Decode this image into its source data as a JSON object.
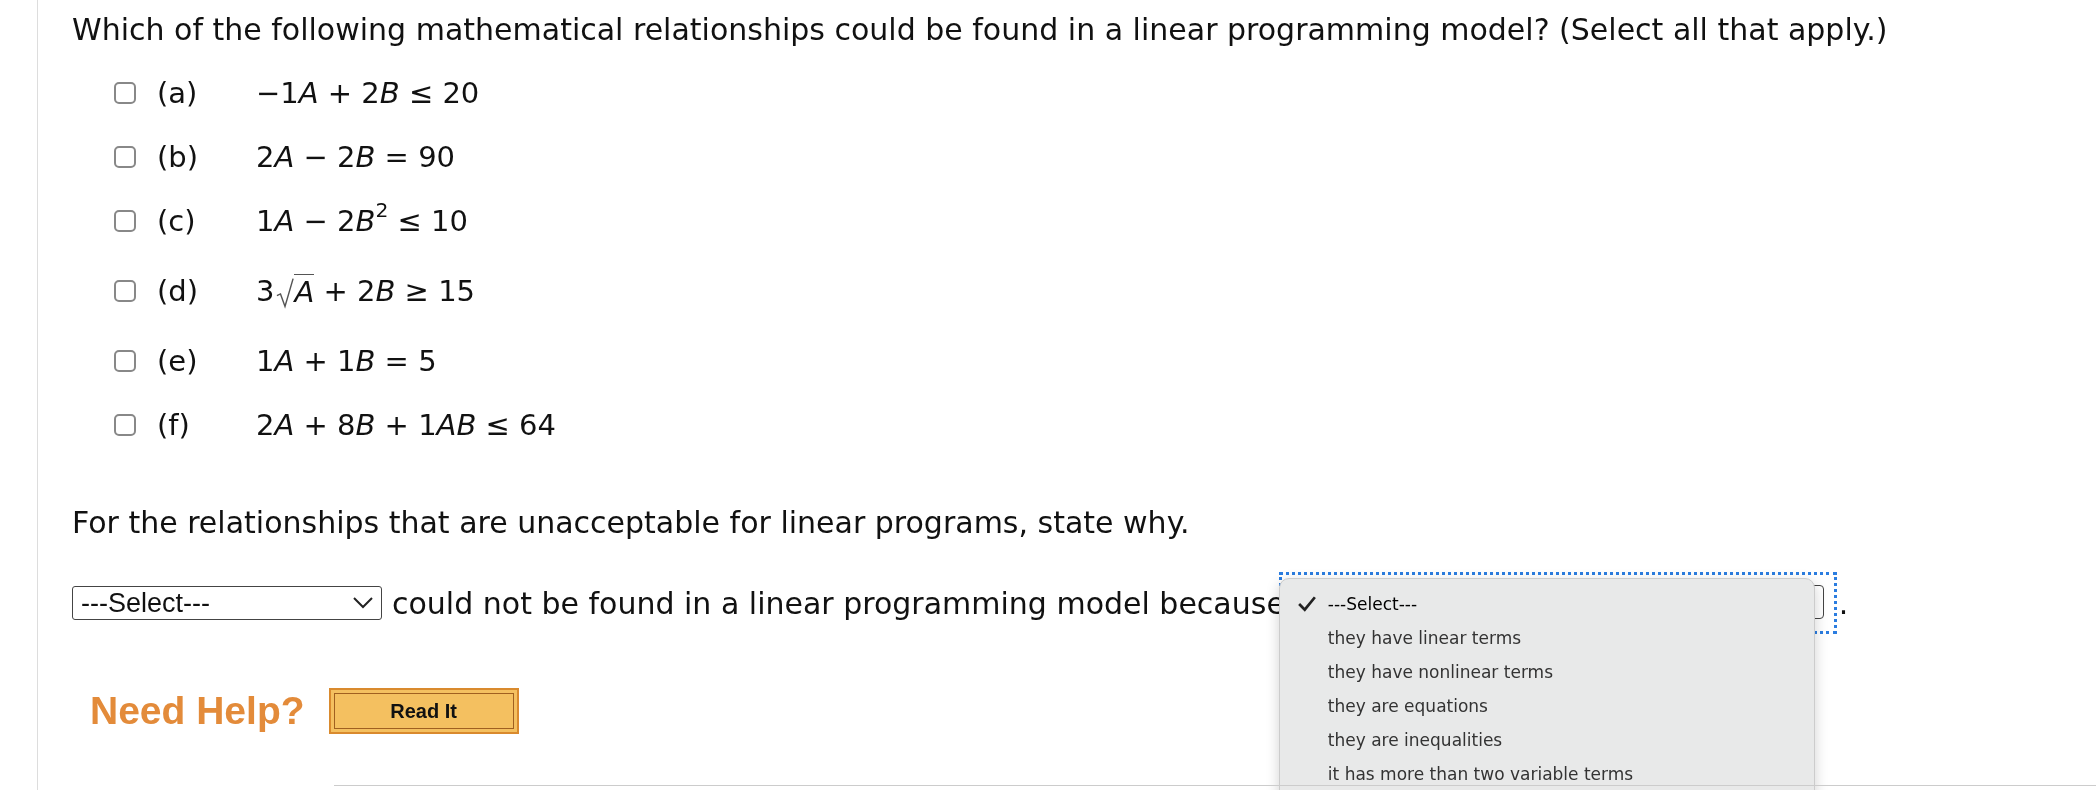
{
  "question": "Which of the following mathematical relationships could be found in a linear programming model? (Select all that apply.)",
  "options": [
    {
      "label": "(a)",
      "checked": false,
      "kind": "plain",
      "formula": [
        {
          "kind": "num",
          "text": "−1"
        },
        {
          "kind": "var",
          "text": "A"
        },
        {
          "kind": "num",
          "text": " + 2"
        },
        {
          "kind": "var",
          "text": "B"
        },
        {
          "kind": "num",
          "text": " ≤ 20"
        }
      ]
    },
    {
      "label": "(b)",
      "checked": false,
      "kind": "plain",
      "formula": [
        {
          "kind": "num",
          "text": "2"
        },
        {
          "kind": "var",
          "text": "A"
        },
        {
          "kind": "num",
          "text": " − 2"
        },
        {
          "kind": "var",
          "text": "B"
        },
        {
          "kind": "num",
          "text": " = 90"
        }
      ]
    },
    {
      "label": "(c)",
      "checked": false,
      "kind": "plain",
      "formula": [
        {
          "kind": "num",
          "text": "1"
        },
        {
          "kind": "var",
          "text": "A"
        },
        {
          "kind": "num",
          "text": " − 2"
        },
        {
          "kind": "var",
          "text": "B"
        },
        {
          "kind": "sup",
          "text": "2"
        },
        {
          "kind": "num",
          "text": " ≤ 10"
        }
      ]
    },
    {
      "label": "(d)",
      "checked": false,
      "kind": "sqrt",
      "coefficient": "3",
      "radicand": "A",
      "formula": [
        {
          "kind": "num",
          "text": " + 2"
        },
        {
          "kind": "var",
          "text": "B"
        },
        {
          "kind": "num",
          "text": " ≥ 15"
        }
      ]
    },
    {
      "label": "(e)",
      "checked": false,
      "kind": "plain",
      "formula": [
        {
          "kind": "num",
          "text": "1"
        },
        {
          "kind": "var",
          "text": "A"
        },
        {
          "kind": "num",
          "text": " + 1"
        },
        {
          "kind": "var",
          "text": "B"
        },
        {
          "kind": "num",
          "text": " = 5"
        }
      ]
    },
    {
      "label": "(f)",
      "checked": false,
      "kind": "plain",
      "formula": [
        {
          "kind": "num",
          "text": "2"
        },
        {
          "kind": "var",
          "text": "A"
        },
        {
          "kind": "num",
          "text": " + 8"
        },
        {
          "kind": "var",
          "text": "B"
        },
        {
          "kind": "num",
          "text": " + 1"
        },
        {
          "kind": "var",
          "text": "AB"
        },
        {
          "kind": "num",
          "text": " ≤ 64"
        }
      ]
    }
  ],
  "prompt": "For the relationships that are unacceptable for linear programs, state why.",
  "first_select": {
    "value": "---Select---"
  },
  "connector_text": "could not be found in a linear programming model because",
  "end_text": ".",
  "reason_menu": [
    {
      "label": "---Select---",
      "selected": true
    },
    {
      "label": "they have linear terms",
      "selected": false
    },
    {
      "label": "they have nonlinear terms",
      "selected": false
    },
    {
      "label": "they are equations",
      "selected": false
    },
    {
      "label": "they are inequalities",
      "selected": false
    },
    {
      "label": "it has more than two variable terms",
      "selected": false
    }
  ],
  "help": {
    "label": "Need Help?",
    "button": "Read It"
  }
}
